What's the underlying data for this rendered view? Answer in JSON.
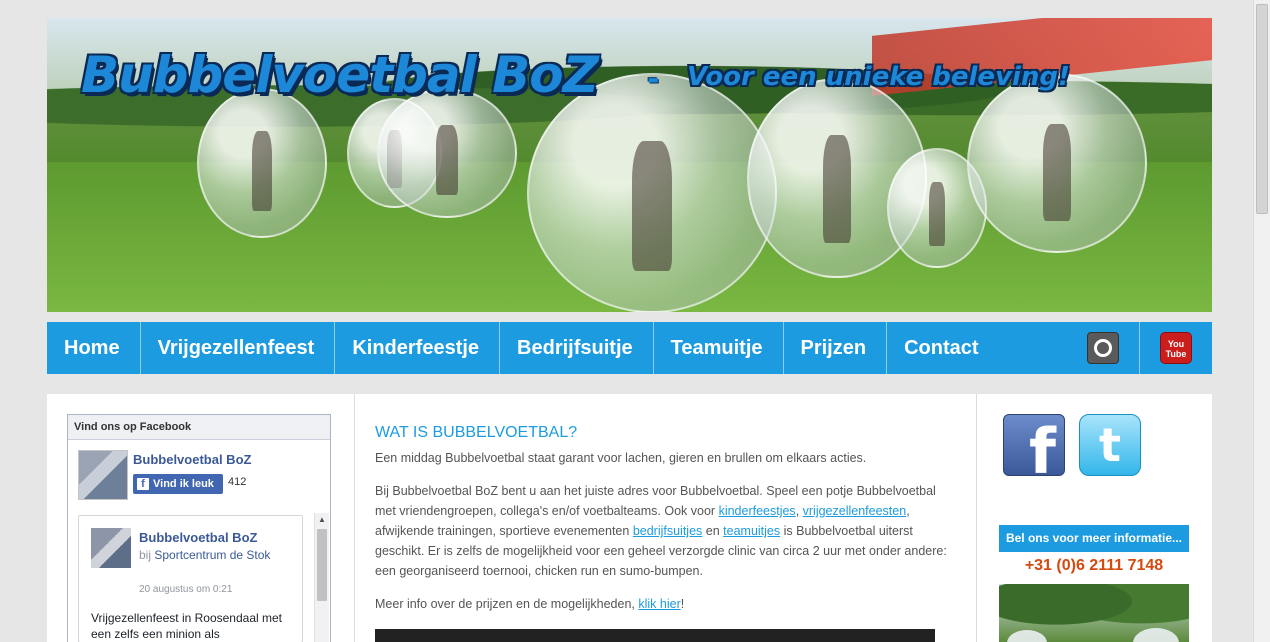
{
  "banner": {
    "title": "Bubbelvoetbal BoZ",
    "dash": "-",
    "tagline": "Voor een unieke beleving!"
  },
  "nav": {
    "items": [
      "Home",
      "Vrijgezellenfeest",
      "Kinderfeestje",
      "Bedrijfsuitje",
      "Teamuitje",
      "Prijzen",
      "Contact"
    ],
    "icons": [
      "photo-gallery-icon",
      "youtube-icon"
    ],
    "youtube_label": "You Tube"
  },
  "facebook": {
    "header": "Vind ons op Facebook",
    "page_name": "Bubbelvoetbal BoZ",
    "like_label": "Vind ik leuk",
    "like_count": "412",
    "post": {
      "author": "Bubbelvoetbal BoZ",
      "at_prefix": "bij",
      "location": "Sportcentrum de Stok",
      "time": "20 augustus om 0:21",
      "text": "Vrijgezellenfeest in Roosendaal met een zelfs een minion als"
    }
  },
  "main": {
    "heading": "WAT IS BUBBELVOETBAL?",
    "intro": "Een middag Bubbelvoetbal staat garant voor lachen, gieren en brullen om elkaars acties.",
    "p2_a": "Bij Bubbelvoetbal BoZ bent u aan het juiste adres voor Bubbelvoetbal. Speel een potje Bubbelvoetbal met vriendengroepen, collega's en/of voetbalteams. Ook voor ",
    "link_kinderfeestjes": "kinderfeestjes",
    "p2_b": ", ",
    "link_vrijgezellenfeesten": "vrijgezellenfeesten",
    "p2_c": ", afwijkende trainingen, sportieve evenementen ",
    "link_bedrijfsuitjes": "bedrijfsuitjes",
    "p2_d": " en ",
    "link_teamuitjes": "teamuitjes",
    "p2_e": " is Bubbelvoetbal uiterst geschikt. Er is zelfs de mogelijkheid voor een geheel verzorgde clinic van circa 2 uur met onder andere: een georganiseerd toernooi, chicken run en sumo-bumpen.",
    "p3_a": "Meer info over de prijzen en de mogelijkheden, ",
    "link_klik_hier": "klik hier",
    "p3_b": "!"
  },
  "sidebar_right": {
    "social_icons": [
      "facebook-icon",
      "twitter-icon"
    ],
    "facebook_glyph": "f",
    "twitter_glyph": "t",
    "call_text": "Bel ons voor meer informatie...",
    "phone": "+31 (0)6 2111 7148"
  },
  "colors": {
    "accent": "#1d9be0",
    "phone": "#d44a10",
    "facebook": "#3b5998"
  }
}
